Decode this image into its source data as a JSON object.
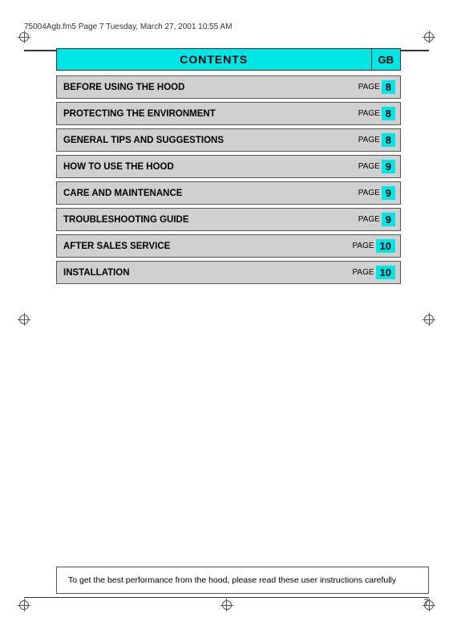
{
  "header": {
    "filename": "75004Agb.fm5  Page 7  Tuesday, March 27, 2001  10:55 AM"
  },
  "contents": {
    "title": "CONTENTS",
    "gb_label": "GB"
  },
  "toc": {
    "items": [
      {
        "title": "BEFORE USING THE HOOD",
        "page": "8"
      },
      {
        "title": "PROTECTING THE ENVIRONMENT",
        "page": "8"
      },
      {
        "title": "GENERAL TIPS AND SUGGESTIONS",
        "page": "8"
      },
      {
        "title": "HOW TO USE THE HOOD",
        "page": "9"
      },
      {
        "title": "CARE AND MAINTENANCE",
        "page": "9"
      },
      {
        "title": "TROUBLESHOOTING GUIDE",
        "page": "9"
      },
      {
        "title": "AFTER SALES SERVICE",
        "page": "10"
      },
      {
        "title": "INSTALLATION",
        "page": "10"
      }
    ],
    "page_label": "PAGE"
  },
  "bottom_note": {
    "text": "To get the best performance from the hood, please read these user instructions carefully"
  },
  "page_number": "7"
}
